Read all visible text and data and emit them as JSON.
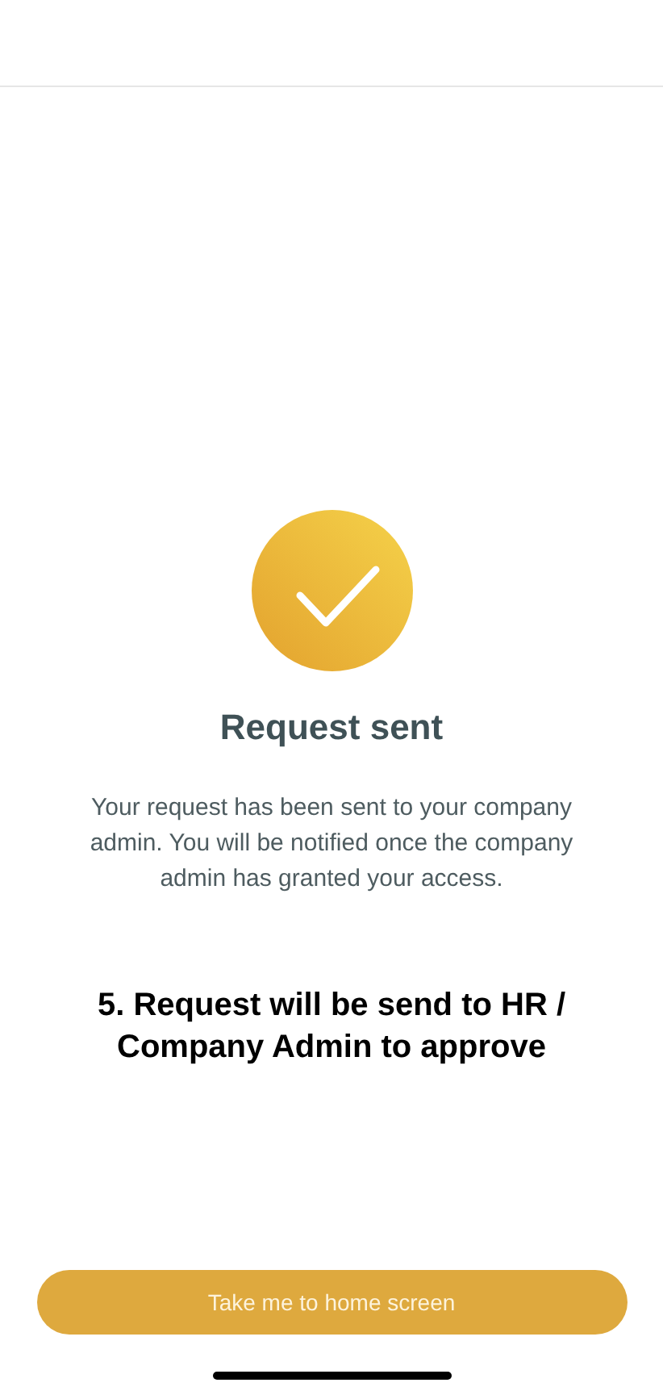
{
  "title": "Request sent",
  "message": "Your request has been sent to your company admin. You will be notified once the company admin has granted your access.",
  "caption": "5. Request will be send to HR / Company Admin to approve",
  "button": "Take me to home screen"
}
